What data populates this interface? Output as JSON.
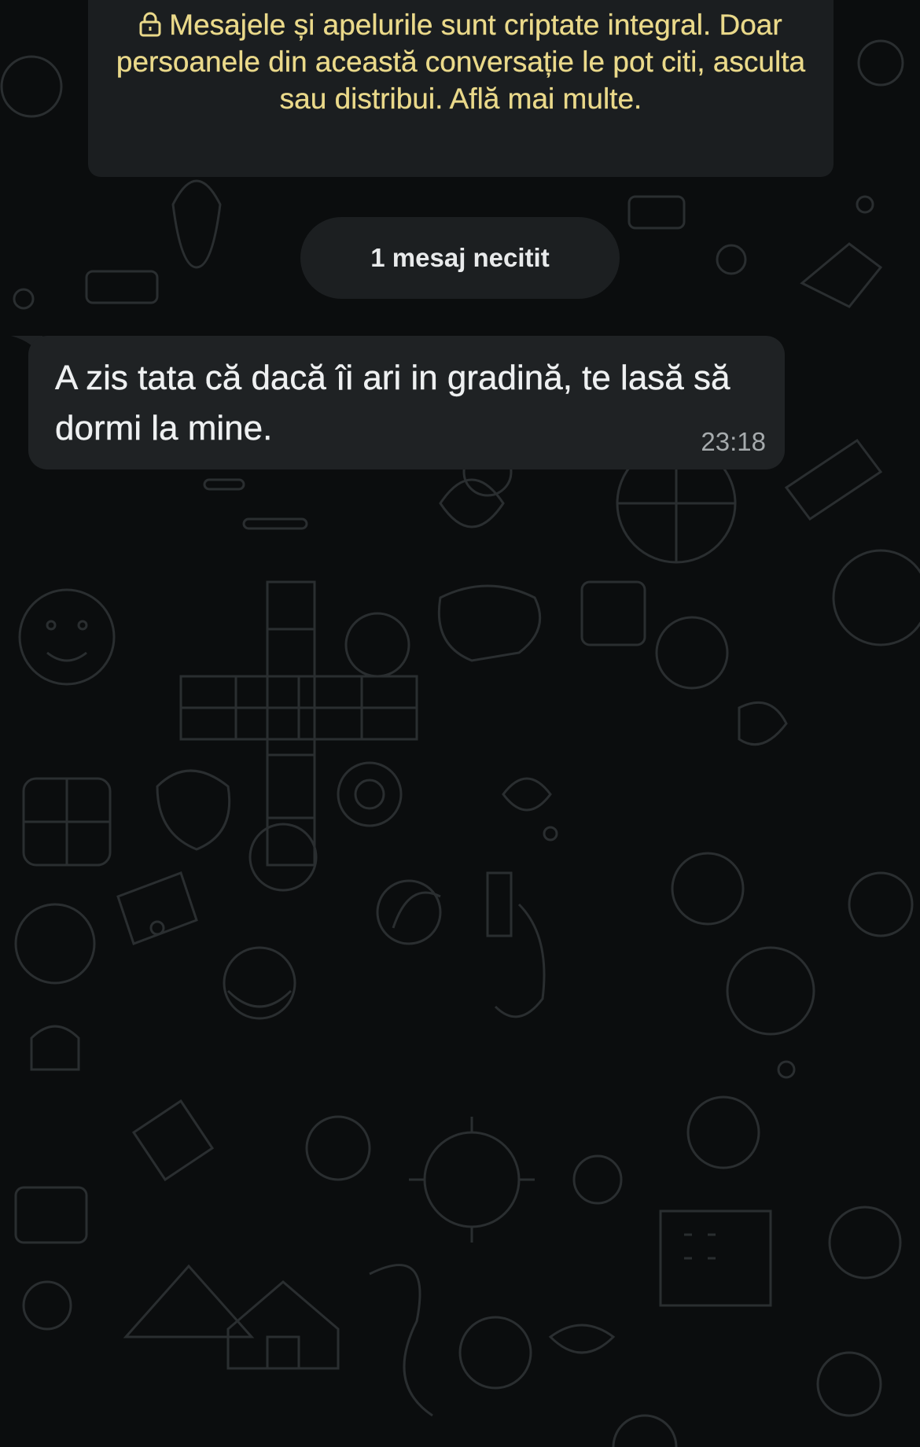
{
  "encryption_notice": {
    "icon": "lock-icon",
    "text": "Mesajele și apelurile sunt criptate integral. Doar persoanele din această conversație le pot citi, asculta sau distribui. Află mai multe."
  },
  "unread_divider": {
    "label": "1 mesaj necitit"
  },
  "messages": [
    {
      "direction": "incoming",
      "text": "A zis tata că dacă îi ari in gradină, te lasă să dormi la mine.",
      "time": "23:18"
    }
  ],
  "colors": {
    "background": "#0b0d0e",
    "notice_text": "#ead98a",
    "bubble_incoming": "#1f2224",
    "pill_bg": "#1c1f21",
    "message_text": "#eef0f1",
    "time_text": "#a6abad"
  }
}
